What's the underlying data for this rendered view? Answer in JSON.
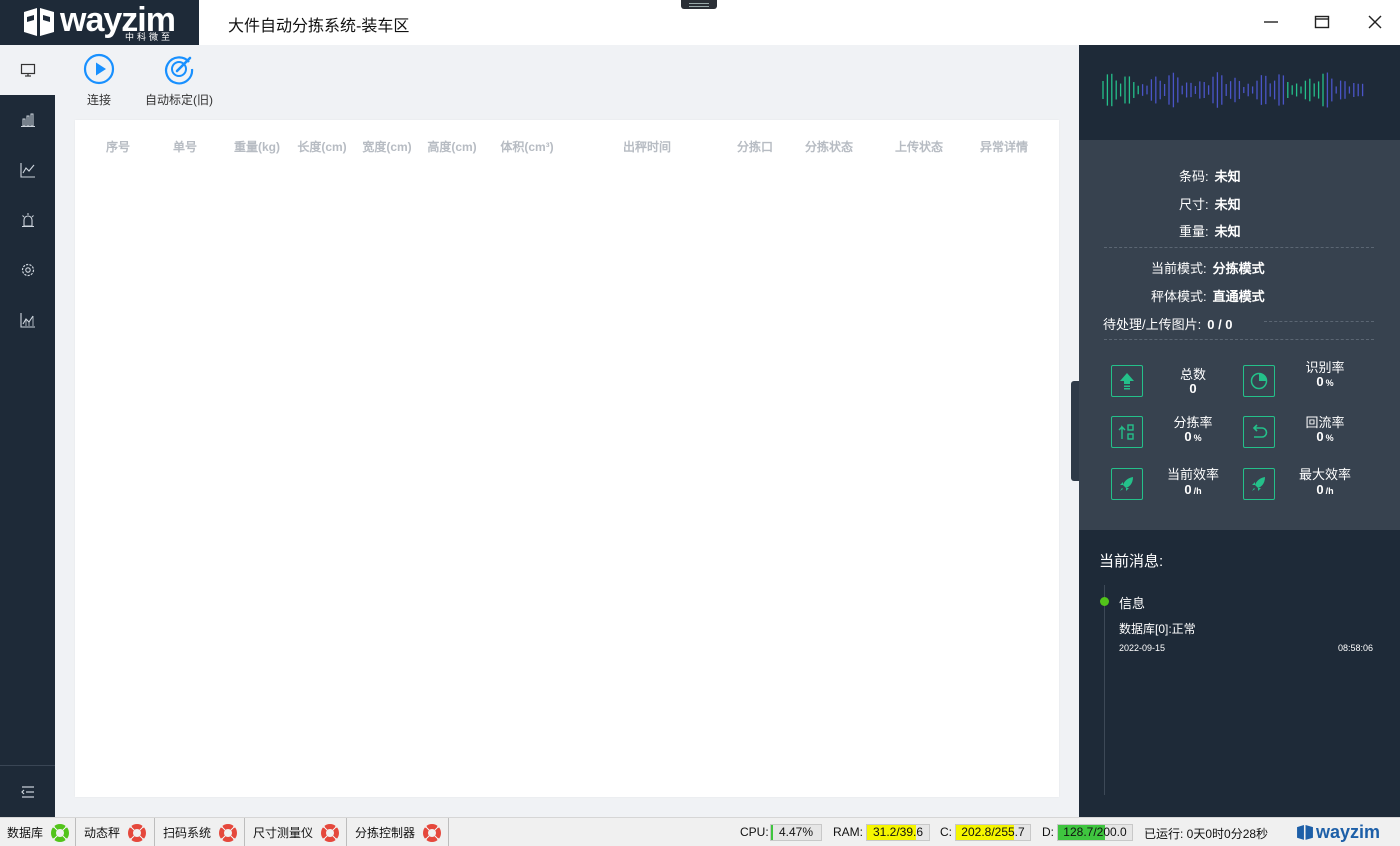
{
  "titlebar": {
    "logo_text": "wayzim",
    "logo_sub": "中科微至",
    "title": "大件自动分拣系统-装车区",
    "minimize": "—",
    "maximize": "☐",
    "close": "✕"
  },
  "sidebar": {
    "items": [
      {
        "icon": "monitor-icon",
        "active": true
      },
      {
        "icon": "bar-chart-icon",
        "active": false
      },
      {
        "icon": "line-chart-icon",
        "active": false
      },
      {
        "icon": "alarm-icon",
        "active": false
      },
      {
        "icon": "gear-icon",
        "active": false
      },
      {
        "icon": "trend-chart-icon",
        "active": false
      }
    ],
    "bottom_icon": "menu-collapse-icon"
  },
  "toolbar": {
    "connect_label": "连接",
    "calibrate_label": "自动标定(旧)"
  },
  "table": {
    "columns": [
      "序号",
      "单号",
      "重量(kg)",
      "长度(cm)",
      "宽度(cm)",
      "高度(cm)",
      "体积(cm³)",
      "出秤时间",
      "分拣口",
      "分拣状态",
      "上传状态",
      "异常详情"
    ],
    "rows": []
  },
  "info": {
    "barcode_label": "条码:",
    "barcode_value": "未知",
    "size_label": "尺寸:",
    "size_value": "未知",
    "weight_label": "重量:",
    "weight_value": "未知",
    "mode_label": "当前模式:",
    "mode_value": "分拣模式",
    "scale_label": "秤体模式:",
    "scale_value": "直通模式",
    "pending_label": "待处理/上传图片:",
    "pending_value": "0 / 0"
  },
  "stats": {
    "total_label": "总数",
    "total_value": "0",
    "recog_label": "识别率",
    "recog_value": "0",
    "sort_label": "分拣率",
    "sort_value": "0",
    "reflow_label": "回流率",
    "reflow_value": "0",
    "cur_eff_label": "当前效率",
    "cur_eff_value": "0",
    "max_eff_label": "最大效率",
    "max_eff_value": "0",
    "percent_unit": "%",
    "per_hour_unit": "/h"
  },
  "messages": {
    "title": "当前消息:",
    "items": [
      {
        "level": "信息",
        "text": "数据库[0]:正常",
        "date": "2022-09-15",
        "time": "08:58:06"
      }
    ]
  },
  "statusbar": {
    "devices": [
      {
        "name": "数据库",
        "status": "ok"
      },
      {
        "name": "动态秤",
        "status": "error"
      },
      {
        "name": "扫码系统",
        "status": "error"
      },
      {
        "name": "尺寸测量仪",
        "status": "error"
      },
      {
        "name": "分拣控制器",
        "status": "error"
      }
    ],
    "cpu_label": "CPU:",
    "cpu_value": "4.47%",
    "cpu_fraction": 0.0447,
    "ram_label": "RAM:",
    "ram_value": "31.2/39.6",
    "ram_fraction": 0.79,
    "c_label": "C:",
    "c_value": "202.8/255.7",
    "c_fraction": 0.79,
    "d_label": "D:",
    "d_value": "128.7/200.0",
    "d_fraction": 0.64,
    "runtime": "已运行: 0天0时0分28秒",
    "logo_text": "wayzim",
    "colors": {
      "green": "#3fc53f",
      "yellow": "#f5f500",
      "accent": "#24c08a",
      "blue": "#1890ff"
    }
  }
}
